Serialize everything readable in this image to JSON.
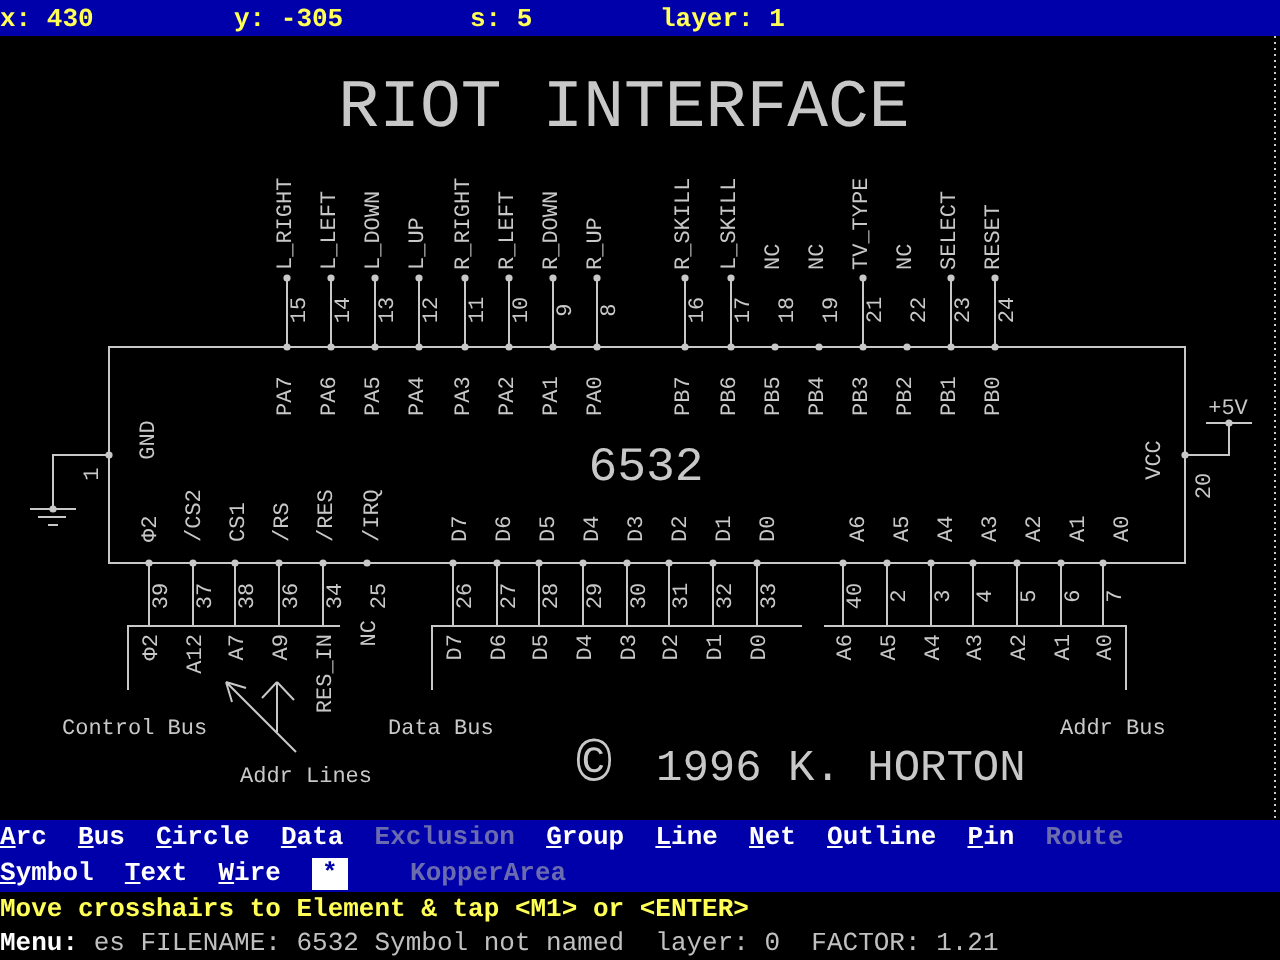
{
  "cursor_readout": [
    "x: 430",
    "y: -305",
    "s: 5",
    "layer: 1"
  ],
  "schematic": {
    "title": "RIOT INTERFACE",
    "chip": "6532",
    "top_pins": [
      {
        "signal": "L_RIGHT",
        "number": "15",
        "port": "PA7",
        "connected": true
      },
      {
        "signal": "L_LEFT",
        "number": "14",
        "port": "PA6",
        "connected": true
      },
      {
        "signal": "L_DOWN",
        "number": "13",
        "port": "PA5",
        "connected": true
      },
      {
        "signal": "L_UP",
        "number": "12",
        "port": "PA4",
        "connected": true
      },
      {
        "signal": "R_RIGHT",
        "number": "11",
        "port": "PA3",
        "connected": true
      },
      {
        "signal": "R_LEFT",
        "number": "10",
        "port": "PA2",
        "connected": true
      },
      {
        "signal": "R_DOWN",
        "number": "9",
        "port": "PA1",
        "connected": true
      },
      {
        "signal": "R_UP",
        "number": "8",
        "port": "PA0",
        "connected": true
      },
      {
        "signal": "R_SKILL",
        "number": "16",
        "port": "PB7",
        "connected": true
      },
      {
        "signal": "L_SKILL",
        "number": "17",
        "port": "PB6",
        "connected": true
      },
      {
        "signal": "NC",
        "number": "18",
        "port": "PB5",
        "connected": false
      },
      {
        "signal": "NC",
        "number": "19",
        "port": "PB4",
        "connected": false
      },
      {
        "signal": "TV_TYPE",
        "number": "21",
        "port": "PB3",
        "connected": true
      },
      {
        "signal": "NC",
        "number": "22",
        "port": "PB2",
        "connected": false
      },
      {
        "signal": "SELECT",
        "number": "23",
        "port": "PB1",
        "connected": true
      },
      {
        "signal": "RESET",
        "number": "24",
        "port": "PB0",
        "connected": true
      }
    ],
    "bottom_pins": [
      {
        "port": "Φ2",
        "number": "39",
        "net": "Φ2",
        "connected": true
      },
      {
        "port": "/CS2",
        "number": "37",
        "net": "A12",
        "connected": true
      },
      {
        "port": "CS1",
        "number": "38",
        "net": "A7",
        "connected": true
      },
      {
        "port": "/RS",
        "number": "36",
        "net": "A9",
        "connected": true
      },
      {
        "port": "/RES",
        "number": "34",
        "net": "RES_IN",
        "connected": true
      },
      {
        "port": "/IRQ",
        "number": "25",
        "net": "NC",
        "connected": false
      },
      {
        "port": "D7",
        "number": "26",
        "net": "D7",
        "connected": true
      },
      {
        "port": "D6",
        "number": "27",
        "net": "D6",
        "connected": true
      },
      {
        "port": "D5",
        "number": "28",
        "net": "D5",
        "connected": true
      },
      {
        "port": "D4",
        "number": "29",
        "net": "D4",
        "connected": true
      },
      {
        "port": "D3",
        "number": "30",
        "net": "D3",
        "connected": true
      },
      {
        "port": "D2",
        "number": "31",
        "net": "D2",
        "connected": true
      },
      {
        "port": "D1",
        "number": "32",
        "net": "D1",
        "connected": true
      },
      {
        "port": "D0",
        "number": "33",
        "net": "D0",
        "connected": true
      },
      {
        "port": "A6",
        "number": "40",
        "net": "A6",
        "connected": true
      },
      {
        "port": "A5",
        "number": "2",
        "net": "A5",
        "connected": true
      },
      {
        "port": "A4",
        "number": "3",
        "net": "A4",
        "connected": true
      },
      {
        "port": "A3",
        "number": "4",
        "net": "A3",
        "connected": true
      },
      {
        "port": "A2",
        "number": "5",
        "net": "A2",
        "connected": true
      },
      {
        "port": "A1",
        "number": "6",
        "net": "A1",
        "connected": true
      },
      {
        "port": "A0",
        "number": "7",
        "net": "A0",
        "connected": true
      }
    ],
    "left_pin": {
      "port": "GND",
      "number": "1"
    },
    "right_pin": {
      "port": "VCC",
      "number": "20",
      "net": "+5V"
    },
    "buses": [
      "Control Bus",
      "Data Bus",
      "Addr Bus"
    ],
    "annotation": "Addr Lines",
    "copyright_symbol": "©",
    "copyright": "1996 K. HORTON"
  },
  "menu_rows": [
    [
      {
        "label": "Arc",
        "disabled": false,
        "selected": false
      },
      {
        "label": "Bus",
        "disabled": false,
        "selected": false
      },
      {
        "label": "Circle",
        "disabled": false,
        "selected": false
      },
      {
        "label": "Data",
        "disabled": false,
        "selected": false
      },
      {
        "label": "Exclusion",
        "disabled": true,
        "selected": false
      },
      {
        "label": "Group",
        "disabled": false,
        "selected": false
      },
      {
        "label": "Line",
        "disabled": false,
        "selected": false
      },
      {
        "label": "Net",
        "disabled": false,
        "selected": false
      },
      {
        "label": "Outline",
        "disabled": false,
        "selected": false
      },
      {
        "label": "Pin",
        "disabled": false,
        "selected": false
      },
      {
        "label": "Route",
        "disabled": true,
        "selected": false
      }
    ],
    [
      {
        "label": "Symbol",
        "disabled": false,
        "selected": false
      },
      {
        "label": "Text",
        "disabled": false,
        "selected": false
      },
      {
        "label": "Wire",
        "disabled": false,
        "selected": false
      },
      {
        "label": "*",
        "disabled": false,
        "selected": true
      },
      {
        "label": "KopperArea",
        "disabled": true,
        "selected": false
      }
    ]
  ],
  "prompt": "Move crosshairs to Element & tap <M1> or <ENTER>",
  "status": {
    "label": "Menu:",
    "text": "es FILENAME: 6532 Symbol not named  layer: 0  FACTOR: 1.21"
  }
}
